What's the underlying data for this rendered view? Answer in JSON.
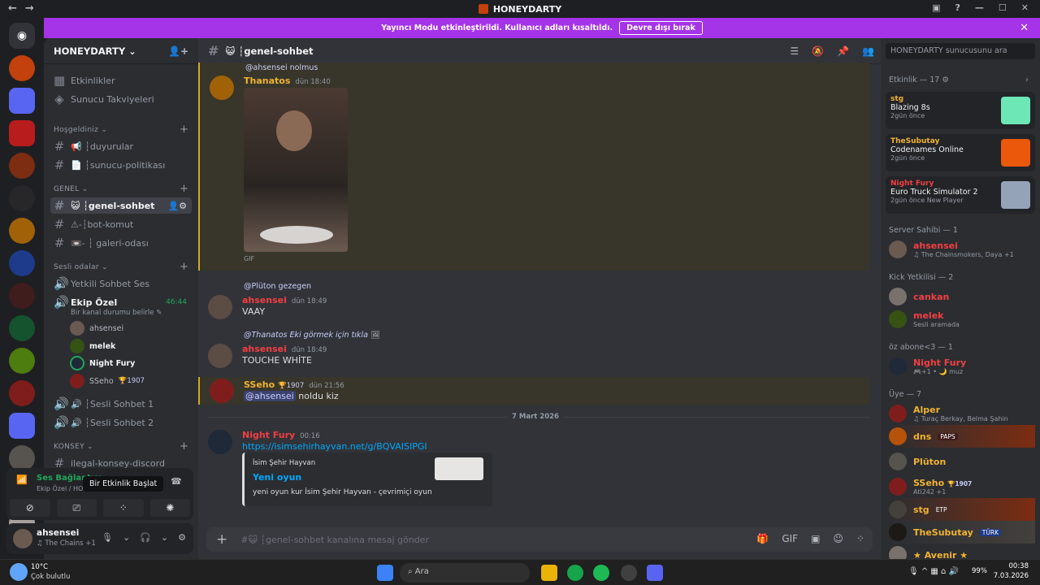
{
  "window": {
    "title": "HONEYDARTY",
    "nav_back": "←",
    "nav_fwd": "→",
    "ctl_min": "—",
    "ctl_max": "☐",
    "ctl_close": "✕"
  },
  "banner": {
    "text": "Yayıncı Modu etkinleştirildi. Kullanıcı adları kısaltıldı.",
    "button": "Devre dışı bırak"
  },
  "server": {
    "name": "HONEYDARTY"
  },
  "sidebar": {
    "top": [
      "Etkinlikler",
      "Sunucu Takviyeleri"
    ],
    "categories": {
      "hosgeldiniz": "Hoşgeldiniz",
      "genel": "GENEL",
      "sesli": "Sesli odalar",
      "konsey": "KONSEY"
    },
    "channels": {
      "duyurular": "📢 ┆duyurular",
      "politika": "📄 ┆sunucu-politikası",
      "genel": "😺 ┆genel-sohbet",
      "bot": "⚠-┆bot-komut",
      "galeri": "📼- ┆ galeri-odası",
      "yetkili": "Yetkili Sohbet Ses",
      "ekip": "Ekip Özel",
      "ekip_status": "Bir kanal durumu belirle",
      "ekip_timer": "46:44",
      "sesli1": "🔊 ┆Sesli Sohbet 1",
      "sesli2": "🔊 ┆Sesli Sohbet 2",
      "konsey": "ilegal-konsey-discord"
    },
    "voice_users": [
      {
        "name": "ahsensei"
      },
      {
        "name": "melek"
      },
      {
        "name": "Night Fury"
      },
      {
        "name": "SSeho",
        "badge": "🏆1907"
      }
    ]
  },
  "voice_panel": {
    "title": "Ses Bağlantısı",
    "sub": "Ekip Özel / HO",
    "tooltip": "Bir Etkinlik Başlat"
  },
  "user_panel": {
    "name": "ahsensei",
    "status": "♫ The Chains +1"
  },
  "channel": {
    "name": "😺 ┆genel-sohbet",
    "input_placeholder": "#😺 ┆genel-sohbet kanalına mesaj gönder"
  },
  "messages": [
    {
      "reply": "@ahsensei nolmus",
      "user": "Thanatos",
      "ts": "dün 18:40",
      "body": "GIF"
    },
    {
      "reply": "@Plüton gezegen",
      "user": "ahsensei",
      "ts": "dün 18:49",
      "body": "VAAY"
    },
    {
      "reply": "@Thanatos Eki görmek için tıkla",
      "user": "ahsensei",
      "ts": "dün 18:49",
      "body": "TOUCHE WHİTE"
    },
    {
      "user": "SSeho",
      "badge": "🏆1907",
      "ts": "dün 21:56",
      "mention": "@ahsensei",
      "body": "noldu kiz"
    },
    {
      "divider": "7 Mart 2026"
    },
    {
      "user": "Night Fury",
      "ts": "00:16",
      "link": "https://isimsehirhayvan.net/g/BQVAISIPGI",
      "embed_site": "İsim Şehir Hayvan",
      "embed_title": "Yeni oyun",
      "embed_desc": "yeni oyun kur İsim Şehir Hayvan - çevrimiçi oyun"
    }
  ],
  "rightbar": {
    "search": "HONEYDARTY sunucusunu ara",
    "activity_header": "Etkinlik — 17",
    "activities": [
      {
        "user": "stg",
        "game": "Blazing 8s",
        "time": "2gün önce"
      },
      {
        "user": "TheSubutay",
        "game": "Codenames Online",
        "time": "2gün önce"
      },
      {
        "user": "Night Fury",
        "game": "Euro Truck Simulator 2",
        "time": "2gün önce",
        "extra": "New Player"
      }
    ],
    "groups": [
      {
        "header": "Server Sahibi — 1",
        "members": [
          {
            "name": "ahsensei",
            "status": "♫ The Chainsmokers, Daya +1",
            "color": "#f23f42"
          }
        ]
      },
      {
        "header": "Kick Yetkilisi — 2",
        "members": [
          {
            "name": "cankan",
            "status": "",
            "color": "#f23f42"
          },
          {
            "name": "melek",
            "status": "Sesli aramada",
            "color": "#f23f42"
          }
        ]
      },
      {
        "header": "öz abone<3 — 1",
        "members": [
          {
            "name": "Night Fury",
            "status": "🎮+1 • 🌙 muz",
            "color": "#f23f42"
          }
        ]
      },
      {
        "header": "Üye — 7",
        "members": [
          {
            "name": "Alper",
            "status": "♫ Turaç Berkay, Belma Şahin",
            "color": "#f0b232"
          },
          {
            "name": "dns",
            "status": "",
            "color": "#f0b232",
            "tag": "PAPS"
          },
          {
            "name": "Plüton",
            "status": "",
            "color": "#f0b232"
          },
          {
            "name": "SSeho",
            "status": "Ati242 +1",
            "color": "#f0b232",
            "tag": "🏆1907"
          },
          {
            "name": "stg",
            "status": "",
            "color": "#f0b232",
            "tag": "ETP"
          },
          {
            "name": "TheSubutay",
            "status": "",
            "color": "#f0b232",
            "tag": "TÜRK"
          },
          {
            "name": "★ Avenir ★",
            "status": "",
            "color": "#f0b232"
          }
        ]
      }
    ]
  },
  "taskbar": {
    "weather_temp": "10°C",
    "weather_desc": "Çok bulutlu",
    "search": "Ara",
    "time": "00:38",
    "date": "7.03.2026",
    "battery": "99%"
  },
  "colors": {
    "accent": "#a533e8",
    "link": "#00a8fc",
    "mention_bg": "#3c4270"
  }
}
